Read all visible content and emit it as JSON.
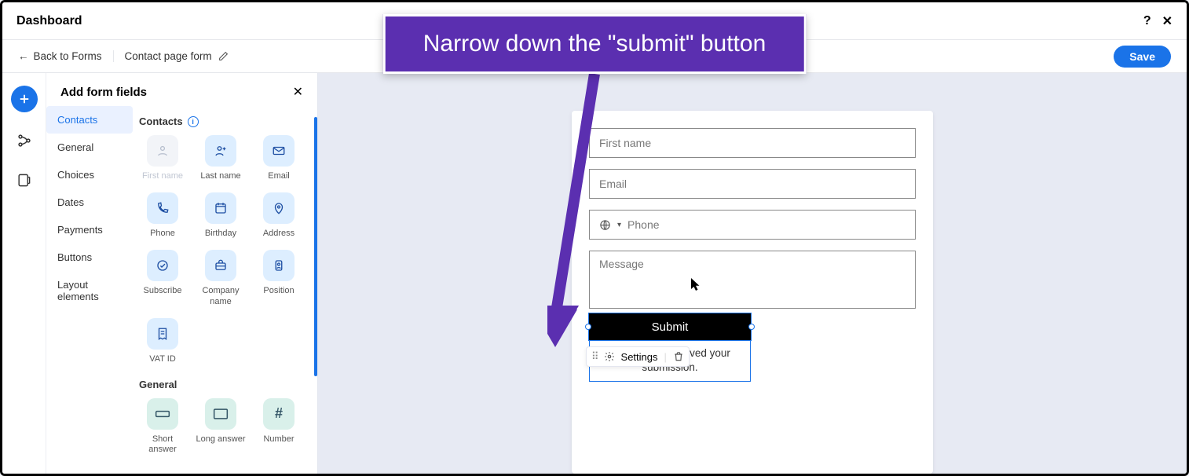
{
  "topbar": {
    "title": "Dashboard",
    "help": "?",
    "close": "✕"
  },
  "crumb": {
    "back": "Back to Forms",
    "name": "Contact page form",
    "save": "Save"
  },
  "panel": {
    "title": "Add form fields",
    "categories": [
      "Contacts",
      "General",
      "Choices",
      "Dates",
      "Payments",
      "Buttons",
      "Layout elements"
    ],
    "group_contacts": "Contacts",
    "group_general": "General",
    "contacts_fields": [
      {
        "label": "First name",
        "disabled": true
      },
      {
        "label": "Last name"
      },
      {
        "label": "Email"
      },
      {
        "label": "Phone"
      },
      {
        "label": "Birthday"
      },
      {
        "label": "Address"
      },
      {
        "label": "Subscribe"
      },
      {
        "label": "Company name"
      },
      {
        "label": "Position"
      },
      {
        "label": "VAT ID"
      }
    ],
    "general_fields": [
      {
        "label": "Short answer"
      },
      {
        "label": "Long answer"
      },
      {
        "label": "Number"
      }
    ]
  },
  "form": {
    "first_name": "First name",
    "email": "Email",
    "phone": "Phone",
    "message": "Message",
    "settings": "Settings",
    "submit": "Submit",
    "thanks": "Thanks, we received your submission."
  },
  "annotation": "Narrow down the \"submit\" button"
}
